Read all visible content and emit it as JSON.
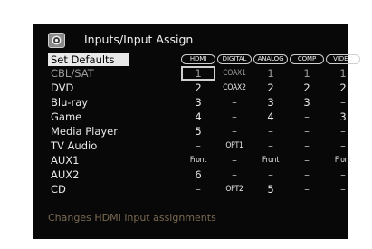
{
  "title": "Inputs/Input Assign",
  "header": {
    "set_defaults": "Set Defaults",
    "columns": [
      "HDMI",
      "DIGITAL",
      "ANALOG",
      "COMP",
      "VIDEO"
    ]
  },
  "rows": [
    {
      "label": "CBL/SAT",
      "cells": [
        "1",
        "COAX1",
        "1",
        "1",
        "1"
      ]
    },
    {
      "label": "DVD",
      "cells": [
        "2",
        "COAX2",
        "2",
        "2",
        "2"
      ]
    },
    {
      "label": "Blu-ray",
      "cells": [
        "3",
        "–",
        "3",
        "3",
        "–"
      ]
    },
    {
      "label": "Game",
      "cells": [
        "4",
        "–",
        "4",
        "–",
        "3"
      ]
    },
    {
      "label": "Media Player",
      "cells": [
        "5",
        "–",
        "–",
        "–",
        "–"
      ]
    },
    {
      "label": "TV Audio",
      "cells": [
        "–",
        "OPT1",
        "–",
        "–",
        "–"
      ]
    },
    {
      "label": "AUX1",
      "cells": [
        "Front",
        "–",
        "Front",
        "–",
        "Front"
      ]
    },
    {
      "label": "AUX2",
      "cells": [
        "6",
        "–",
        "–",
        "–",
        "–"
      ]
    },
    {
      "label": "CD",
      "cells": [
        "–",
        "OPT2",
        "5",
        "–",
        "–"
      ]
    }
  ],
  "hint": "Changes HDMI input assignments",
  "colors": {
    "screen_bg": "#080808",
    "text": "#e8e8e8",
    "dim_text": "#9a9a9a",
    "highlight_bg": "#e8e8e8",
    "hint_text": "#7a6a52"
  },
  "icons": {
    "title": "inputs-gear-icon"
  }
}
